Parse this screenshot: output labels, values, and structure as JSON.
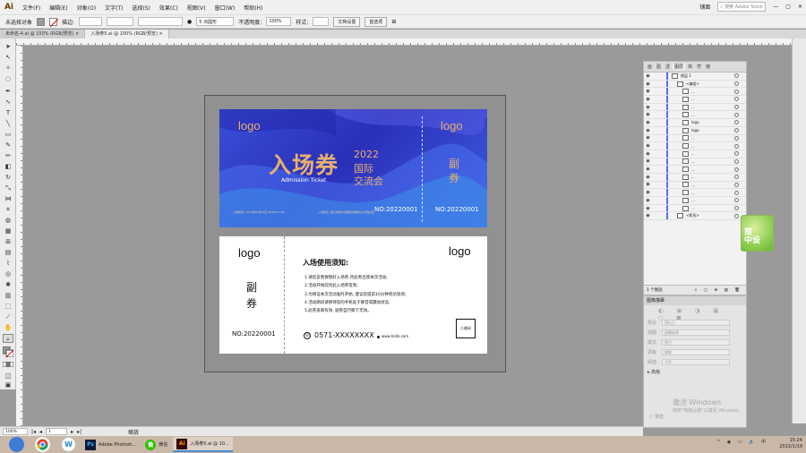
{
  "app": {
    "logo": "Ai"
  },
  "menu": [
    "文件(F)",
    "编辑(E)",
    "对象(O)",
    "文字(T)",
    "选择(S)",
    "效果(C)",
    "视图(V)",
    "窗口(W)",
    "帮助(H)"
  ],
  "menu_right": {
    "layout": "铺面",
    "stock_placeholder": "搜索 Adobe Stock"
  },
  "control_bar": {
    "selection_label": "未选择对象",
    "stroke_label": "描边:",
    "stroke_value": "",
    "brush_label": "5 点圆形",
    "opacity_label": "不透明度:",
    "opacity_value": "100%",
    "style_label": "样式:",
    "doc_setup_button": "文档设置",
    "prefs_button": "首选项"
  },
  "tabs": [
    {
      "label": "未命名-4.ai @ 150% (RGB/预览)",
      "active": false
    },
    {
      "label": "入场券5.ai @ 100% (RGB/预览)",
      "active": true
    }
  ],
  "ticket_top": {
    "logo_left": "logo",
    "title": "入场券",
    "year": "2022",
    "line1": "国际",
    "line2": "交流会",
    "subtitle": "Admission Ticket",
    "small_left": "入场时间: 2022年01月18日 08:30-17:00",
    "small_mid": "入场地点: 浙江省杭州市国际会展中心1号馆A区",
    "no_left": "NO:20220001",
    "logo_right": "logo",
    "stub_fu": "副",
    "stub_quan": "券",
    "no_right": "NO:20220001"
  },
  "ticket_bottom": {
    "logo_left": "logo",
    "fu": "副",
    "quan": "券",
    "no": "NO:20220001",
    "logo_right": "logo",
    "notice_title": "入场使用须知:",
    "rules": [
      "1.请您妥善保管好入场券,凭此券出席本次活动;",
      "2.活动开始前凭此入场券签到;",
      "3.为保证本次活动准时开始, 建议您提前10分钟到达现场;",
      "4.活动期间请保持您的手机处于静音或震动状态;",
      "5.此券盖章有效, 副券自行撕下无效。"
    ],
    "phone": "0571-XXXXXXXX",
    "website": "www.hello.com",
    "qr_label": "二维码"
  },
  "layers_panel": {
    "tabs": [
      "画",
      "图",
      "透",
      "图层",
      "库",
      "符",
      "链"
    ],
    "active_tab": "图层",
    "rows": [
      {
        "name": "图层 1",
        "indent": 0
      },
      {
        "name": "<编组>",
        "indent": 1
      },
      {
        "name": "...",
        "indent": 2
      },
      {
        "name": "...",
        "indent": 2
      },
      {
        "name": "...",
        "indent": 2
      },
      {
        "name": "...",
        "indent": 2
      },
      {
        "name": "logo",
        "indent": 2
      },
      {
        "name": "logo",
        "indent": 2
      },
      {
        "name": "...",
        "indent": 2
      },
      {
        "name": "...",
        "indent": 2
      },
      {
        "name": "...",
        "indent": 2
      },
      {
        "name": "...",
        "indent": 2
      },
      {
        "name": "...",
        "indent": 2
      },
      {
        "name": "...",
        "indent": 2
      },
      {
        "name": "...",
        "indent": 2
      },
      {
        "name": "...",
        "indent": 2
      },
      {
        "name": "...",
        "indent": 2
      },
      {
        "name": "...",
        "indent": 2
      },
      {
        "name": "<矩形>",
        "indent": 1
      }
    ],
    "footer": "1 个图层"
  },
  "trace_panel": {
    "title": "图像描摹",
    "rows": [
      {
        "label": "预设",
        "value": "[默认]"
      },
      {
        "label": "视图",
        "value": "描摹结果"
      },
      {
        "label": "模式",
        "value": "黑白"
      },
      {
        "label": "调板",
        "value": "限制"
      },
      {
        "label": "阈值",
        "value": "128"
      }
    ],
    "advanced": "高级",
    "preview": "预览",
    "activate_title": "激活 Windows",
    "activate_sub": "转到\"电脑设置\"以激活 Windows。"
  },
  "sticker": {
    "line1": "简",
    "line2": "中设"
  },
  "status_bar": {
    "zoom": "100%",
    "artboard": "1",
    "tool": "缩放"
  },
  "taskbar": {
    "apps": [
      {
        "icon": "Ps",
        "label": "Adobe Photosh..."
      },
      {
        "icon": "微",
        "label": "微信"
      },
      {
        "icon": "Ai",
        "label": "入场券5.ai @ 10..."
      }
    ],
    "time": "15:24",
    "date": "2022/1/19"
  },
  "colors": {
    "ticket_blue": "#2a2fb8",
    "gold": "#e8b070",
    "layer_bar": "#4e72e6"
  }
}
